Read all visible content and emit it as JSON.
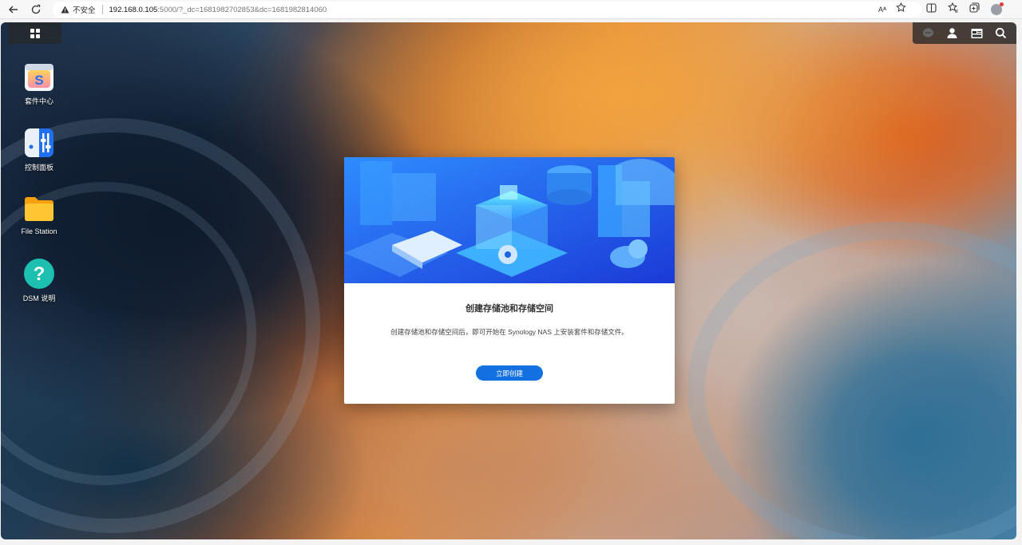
{
  "browser": {
    "security_label": "不安全",
    "url_host": "192.168.0.105",
    "url_rest": ":5000/?_dc=1681982702853&dc=1681982814060",
    "read_aloud": "Aᴬ"
  },
  "desktop": {
    "icons": [
      {
        "label": "套件中心",
        "icon": "package-center-icon"
      },
      {
        "label": "控制面板",
        "icon": "control-panel-icon"
      },
      {
        "label": "File Station",
        "icon": "folder-icon"
      },
      {
        "label": "DSM 说明",
        "icon": "help-icon"
      }
    ]
  },
  "dialog": {
    "title": "创建存储池和存储空间",
    "description": "创建存储池和存储空间后，即可开始在 Synology NAS 上安装套件和存储文件。",
    "button_label": "立即创建"
  },
  "colors": {
    "accent": "#1270e0",
    "banner_top": "#2f8cff",
    "banner_bottom": "#1b3ad6"
  }
}
